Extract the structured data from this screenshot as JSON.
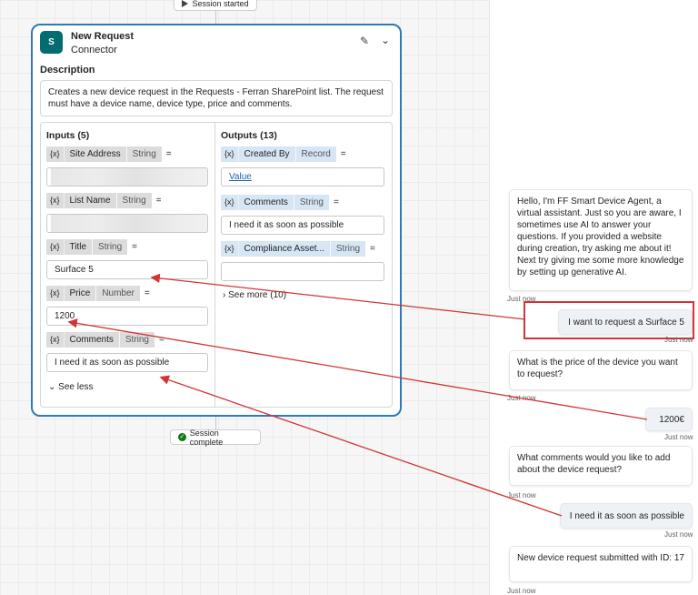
{
  "canvas": {
    "session_started": "Session started",
    "session_complete": "Session complete"
  },
  "card": {
    "title": "New Request",
    "subtitle": "Connector",
    "logo_text": "S",
    "description_label": "Description",
    "description": "Creates a new device request in the Requests - Ferran SharePoint list. The request must have a device name, device type, price and comments.",
    "inputs_header": "Inputs (5)",
    "outputs_header": "Outputs (13)",
    "inputs": [
      {
        "name": "Site Address",
        "type": "String",
        "value": ""
      },
      {
        "name": "List Name",
        "type": "String",
        "value": ""
      },
      {
        "name": "Title",
        "type": "String",
        "value": "Surface 5"
      },
      {
        "name": "Price",
        "type": "Number",
        "value": "1200"
      },
      {
        "name": "Comments",
        "type": "String",
        "value": "I need it as soon as possible"
      }
    ],
    "outputs": [
      {
        "name": "Created By",
        "type": "Record",
        "value": "Value"
      },
      {
        "name": "Comments",
        "type": "String",
        "value": "I need it as soon as possible"
      },
      {
        "name": "Compliance Asset...",
        "type": "String",
        "value": ""
      }
    ],
    "var_symbol": "{x}",
    "equals": "=",
    "see_more": "See more (10)",
    "see_less": "See less",
    "icons": {
      "edit": "pencil-icon",
      "collapse": "chevron-down-icon"
    }
  },
  "chat": {
    "messages": [
      {
        "role": "bot",
        "text": "Hello, I'm FF Smart Device Agent, a virtual assistant. Just so you are aware, I sometimes use AI to answer your questions. If you provided a website during creation, try asking me about it! Next try giving me some more knowledge by setting up generative AI.",
        "time": "Just now"
      },
      {
        "role": "user",
        "text": "I want to request a Surface 5",
        "time": "Just now"
      },
      {
        "role": "bot",
        "text": "What is the price of the device you want to request?",
        "time": "Just now"
      },
      {
        "role": "user",
        "text": "1200€",
        "time": "Just now"
      },
      {
        "role": "bot",
        "text": "What comments would you like to add about the device request?",
        "time": "Just now"
      },
      {
        "role": "user",
        "text": "I need it as soon as possible",
        "time": "Just now"
      },
      {
        "role": "bot",
        "text": "New device request submitted with ID: 17",
        "time": "Just now"
      }
    ]
  },
  "colors": {
    "accent_border": "#2f7ab5",
    "annotation_red": "#d13438",
    "connector_logo": "#036c70",
    "success": "#107c10"
  }
}
